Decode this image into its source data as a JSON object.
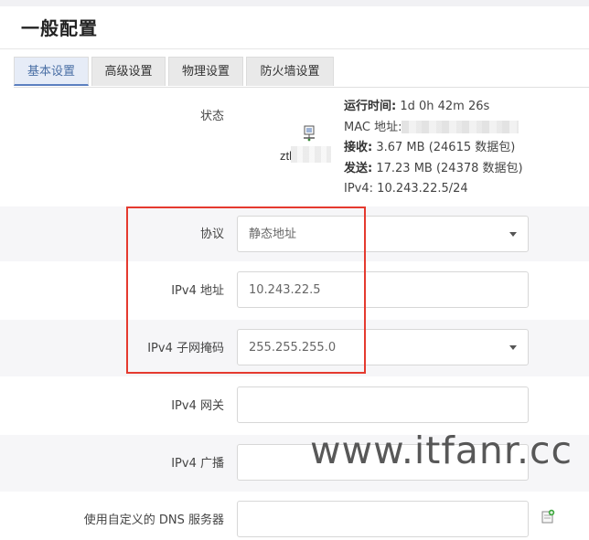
{
  "page": {
    "title": "一般配置"
  },
  "tabs": [
    {
      "label": "基本设置",
      "active": true
    },
    {
      "label": "高级设置",
      "active": false
    },
    {
      "label": "物理设置",
      "active": false
    },
    {
      "label": "防火墙设置",
      "active": false
    }
  ],
  "status": {
    "label": "状态",
    "device_name": "ztl",
    "uptime_label": "运行时间:",
    "uptime_value": "1d 0h 42m 26s",
    "mac_label": "MAC 地址:",
    "rx_label": "接收:",
    "rx_value": "3.67 MB (24615 数据包)",
    "tx_label": "发送:",
    "tx_value": "17.23 MB (24378 数据包)",
    "ipv4_label": "IPv4:",
    "ipv4_value": "10.243.22.5/24"
  },
  "form": {
    "protocol": {
      "label": "协议",
      "value": "静态地址"
    },
    "ipv4_addr": {
      "label": "IPv4 地址",
      "value": "10.243.22.5"
    },
    "netmask": {
      "label": "IPv4 子网掩码",
      "value": "255.255.255.0"
    },
    "gateway": {
      "label": "IPv4 网关",
      "value": ""
    },
    "broadcast": {
      "label": "IPv4 广播",
      "value": ""
    },
    "dns": {
      "label": "使用自定义的 DNS 服务器",
      "value": ""
    }
  },
  "watermark": "www.itfanr.cc",
  "colors": {
    "highlight_box": "#e53a2f",
    "active_tab": "#e6ecf7"
  },
  "icons": {
    "device": "network-device-icon",
    "add": "add-entry-icon"
  }
}
